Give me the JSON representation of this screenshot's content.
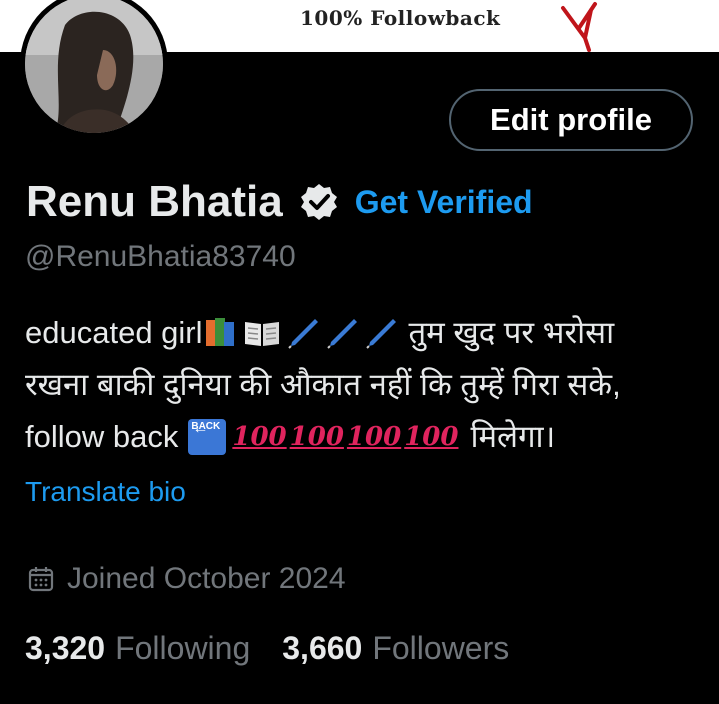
{
  "banner": {
    "text": "100% Followback",
    "arrow_icon": "red-arrow-down-icon"
  },
  "profile": {
    "avatar_icon": "avatar-photo",
    "edit_label": "Edit profile",
    "name": "Renu Bhatia",
    "verified_icon": "verified-badge-icon",
    "get_verified_label": "Get Verified",
    "handle": "@RenuBhatia83740",
    "bio": {
      "line1_text": "educated girl",
      "line1_hindi": "तुम खुद पर भरोसा",
      "line2": "रखना बाकी दुनिया की औकात नहीं कि तुम्हें गिरा सके,",
      "line3_text": "follow back",
      "back_label": "BACK",
      "hundred": "100",
      "line3_hindi": "मिलेगा।"
    },
    "translate_label": "Translate bio",
    "joined": "Joined October 2024",
    "following_count": "3,320",
    "following_label": "Following",
    "followers_count": "3,660",
    "followers_label": "Followers"
  },
  "colors": {
    "accent": "#1d9bf0",
    "muted": "#71767b",
    "background": "#000000",
    "text": "#e7e9ea"
  }
}
